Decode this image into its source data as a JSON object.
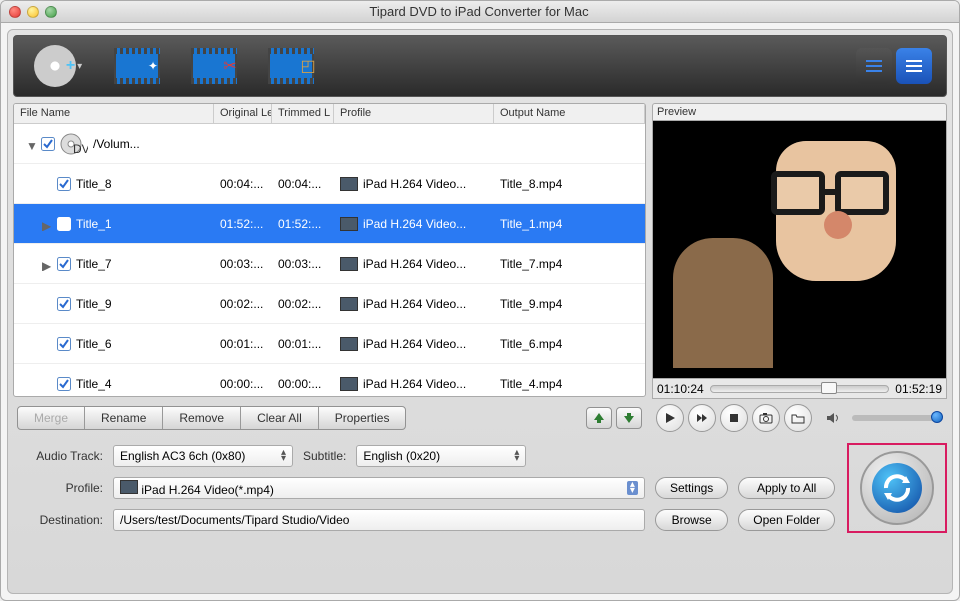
{
  "window": {
    "title": "Tipard DVD to iPad Converter for Mac"
  },
  "columns": {
    "filename": "File Name",
    "origlen": "Original Le",
    "trimlen": "Trimmed L",
    "profile": "Profile",
    "outname": "Output Name"
  },
  "rootItem": {
    "name": "/Volum..."
  },
  "items": [
    {
      "name": "Title_8",
      "orig": "00:04:...",
      "trim": "00:04:...",
      "profile": "iPad H.264 Video...",
      "out": "Title_8.mp4",
      "sel": false,
      "exp": null
    },
    {
      "name": "Title_1",
      "orig": "01:52:...",
      "trim": "01:52:...",
      "profile": "iPad H.264 Video...",
      "out": "Title_1.mp4",
      "sel": true,
      "exp": false
    },
    {
      "name": "Title_7",
      "orig": "00:03:...",
      "trim": "00:03:...",
      "profile": "iPad H.264 Video...",
      "out": "Title_7.mp4",
      "sel": false,
      "exp": false
    },
    {
      "name": "Title_9",
      "orig": "00:02:...",
      "trim": "00:02:...",
      "profile": "iPad H.264 Video...",
      "out": "Title_9.mp4",
      "sel": false,
      "exp": null
    },
    {
      "name": "Title_6",
      "orig": "00:01:...",
      "trim": "00:01:...",
      "profile": "iPad H.264 Video...",
      "out": "Title_6.mp4",
      "sel": false,
      "exp": null
    },
    {
      "name": "Title_4",
      "orig": "00:00:...",
      "trim": "00:00:...",
      "profile": "iPad H.264 Video...",
      "out": "Title_4.mp4",
      "sel": false,
      "exp": null
    }
  ],
  "actions": {
    "merge": "Merge",
    "rename": "Rename",
    "remove": "Remove",
    "clear": "Clear All",
    "properties": "Properties"
  },
  "preview": {
    "label": "Preview",
    "current": "01:10:24",
    "total": "01:52:19"
  },
  "options": {
    "audioLabel": "Audio Track:",
    "audioValue": "English AC3 6ch (0x80)",
    "subtitleLabel": "Subtitle:",
    "subtitleValue": "English (0x20)",
    "profileLabel": "Profile:",
    "profileValue": "iPad H.264 Video(*.mp4)",
    "destLabel": "Destination:",
    "destValue": "/Users/test/Documents/Tipard Studio/Video",
    "settings": "Settings",
    "applyAll": "Apply to All",
    "browse": "Browse",
    "openFolder": "Open Folder"
  }
}
